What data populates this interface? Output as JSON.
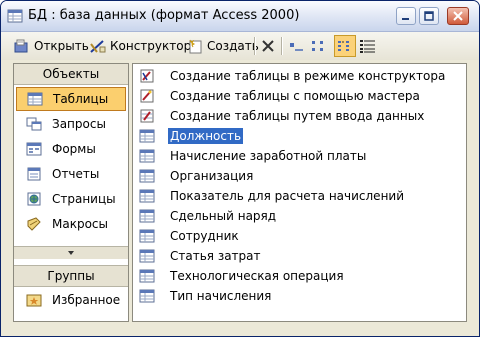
{
  "window": {
    "title": "БД : база данных (формат Access 2000)"
  },
  "toolbar": {
    "open_label": "Открыть",
    "design_label": "Конструктор",
    "create_label": "Создать"
  },
  "sidebar": {
    "objects_header": "Объекты",
    "items": [
      {
        "label": "Таблицы",
        "icon": "table-icon"
      },
      {
        "label": "Запросы",
        "icon": "query-icon"
      },
      {
        "label": "Формы",
        "icon": "form-icon"
      },
      {
        "label": "Отчеты",
        "icon": "report-icon"
      },
      {
        "label": "Страницы",
        "icon": "page-icon"
      },
      {
        "label": "Макросы",
        "icon": "macro-icon"
      }
    ],
    "groups_header": "Группы",
    "favorites_label": "Избранное"
  },
  "list": {
    "wizards": [
      "Создание таблицы в режиме конструктора",
      "Создание таблицы с помощью мастера",
      "Создание таблицы путем ввода данных"
    ],
    "tables": [
      "Должность",
      "Начисление заработной платы",
      "Организация",
      "Показатель для расчета начислений",
      "Сдельный наряд",
      "Сотрудник",
      "Статья затрат",
      "Технологическая операция",
      "Тип начисления"
    ],
    "selected": "Должность"
  },
  "colors": {
    "selection": "#316ac5",
    "sidebar_selected": "#fbcf6e"
  }
}
